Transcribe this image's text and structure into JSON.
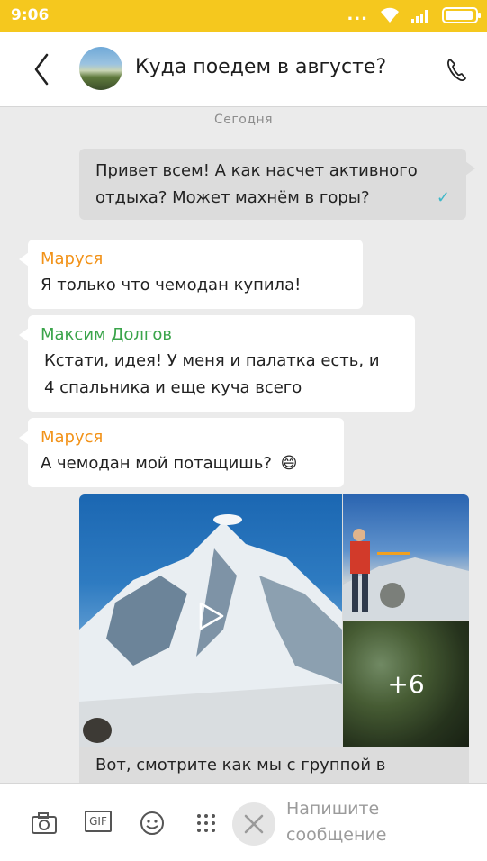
{
  "status_bar": {
    "time": "9:06",
    "dots": "..."
  },
  "header": {
    "title": "Куда поедем в августе?"
  },
  "chat": {
    "date_label": "Сегодня",
    "messages": [
      {
        "direction": "out",
        "text_line1": "Привет всем! А как насчет активного",
        "text_line2": "отдыха?  Может махнём в горы?",
        "status": "✓"
      },
      {
        "direction": "in",
        "sender": "Маруся",
        "sender_color": "#f29218",
        "text": "Я только что чемодан купила!"
      },
      {
        "direction": "in",
        "sender": "Максим Долгов",
        "sender_color": "#3aa44a",
        "text_line1": "Кстати, идея! У меня и палатка есть, и",
        "text_line2": "4 спальника и еще куча всего"
      },
      {
        "direction": "in",
        "sender": "Маруся",
        "sender_color": "#f29218",
        "text": "А чемодан мой потащишь?",
        "emoji": "😄"
      }
    ],
    "media_message": {
      "more_count": "+6",
      "caption": "Вот, смотрите как мы с группой в"
    }
  },
  "composer": {
    "placeholder_line1": "Напишите",
    "placeholder_line2": "сообщение",
    "gif_label": "GIF"
  },
  "colors": {
    "status_bar": "#f5c81e",
    "orange_sender": "#f29218",
    "green_sender": "#3aa44a",
    "read_check": "#3db8c9"
  }
}
